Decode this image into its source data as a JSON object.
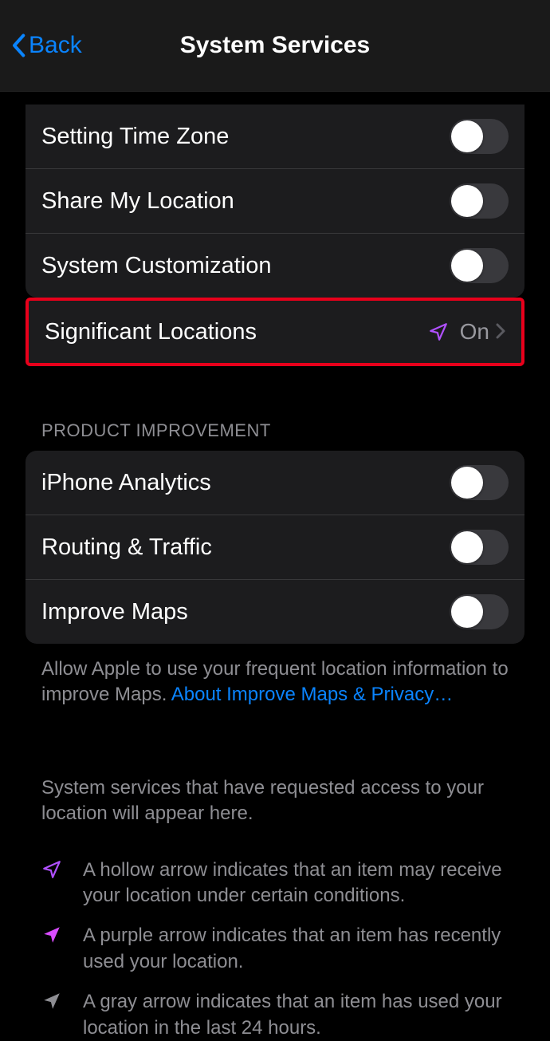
{
  "nav": {
    "back": "Back",
    "title": "System Services"
  },
  "group1": {
    "items": [
      {
        "label": "Setting Time Zone"
      },
      {
        "label": "Share My Location"
      },
      {
        "label": "System Customization"
      }
    ]
  },
  "significant": {
    "label": "Significant Locations",
    "status": "On"
  },
  "section_header": "PRODUCT IMPROVEMENT",
  "group2": {
    "items": [
      {
        "label": "iPhone Analytics"
      },
      {
        "label": "Routing & Traffic"
      },
      {
        "label": "Improve Maps"
      }
    ]
  },
  "footer": {
    "text": "Allow Apple to use your frequent location information to improve Maps. ",
    "link": "About Improve Maps & Privacy…"
  },
  "intro": "System services that have requested access to your location will appear here.",
  "legend": [
    {
      "text": "A hollow arrow indicates that an item may receive your location under certain conditions."
    },
    {
      "text": "A purple arrow indicates that an item has recently used your location."
    },
    {
      "text": "A gray arrow indicates that an item has used your location in the last 24 hours."
    }
  ]
}
